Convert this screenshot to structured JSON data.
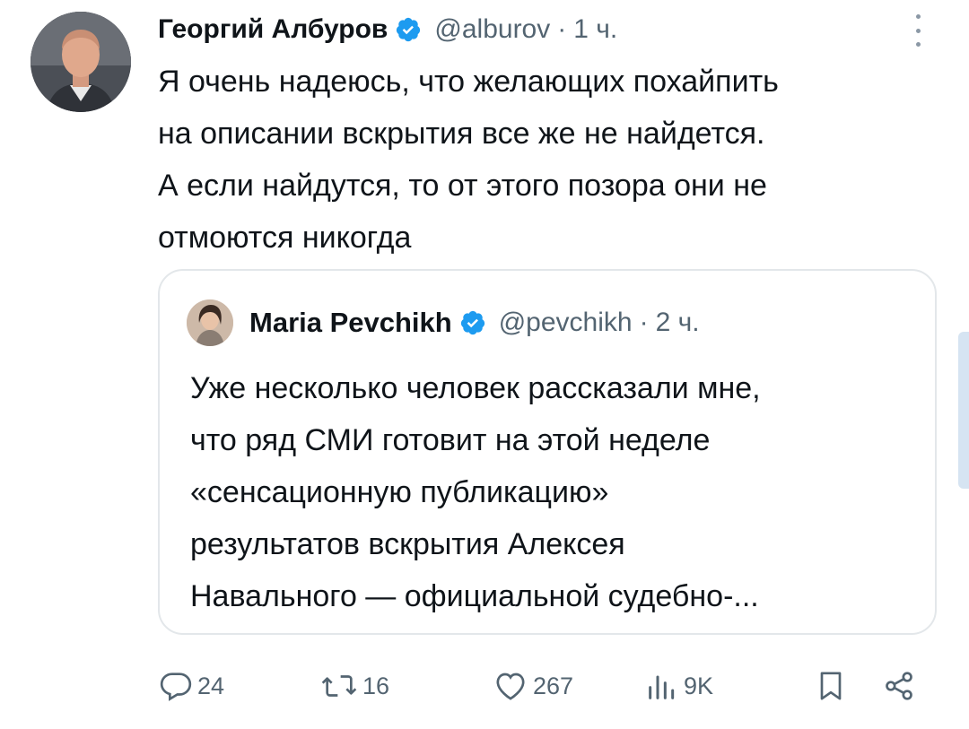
{
  "tweet": {
    "author_name": "Георгий Албуров",
    "handle": "@alburov",
    "separator": "·",
    "time": "1 ч.",
    "avatar_icon": "author-avatar",
    "verified_icon": "verified-badge-icon",
    "text": "Я очень надеюсь, что желающих похайпить\nна описании вскрытия все же не найдется.\nА если найдутся, то от этого позора они не\nотмоются никогда"
  },
  "quoted": {
    "author_name": "Maria Pevchikh",
    "handle": "@pevchikh",
    "separator": "·",
    "time": "2 ч.",
    "text": "Уже несколько человек рассказали мне,\nчто ряд СМИ готовит на этой неделе\n«сенсационную публикацию»\nрезультатов вскрытия Алексея\nНавального — официальной судебно-..."
  },
  "actions": {
    "replies": "24",
    "reposts": "16",
    "likes": "267",
    "views": "9K"
  },
  "colors": {
    "text_primary": "#0f1419",
    "text_secondary": "#536471",
    "verified_blue": "#1d9bf0",
    "border": "#e3e7ea"
  }
}
